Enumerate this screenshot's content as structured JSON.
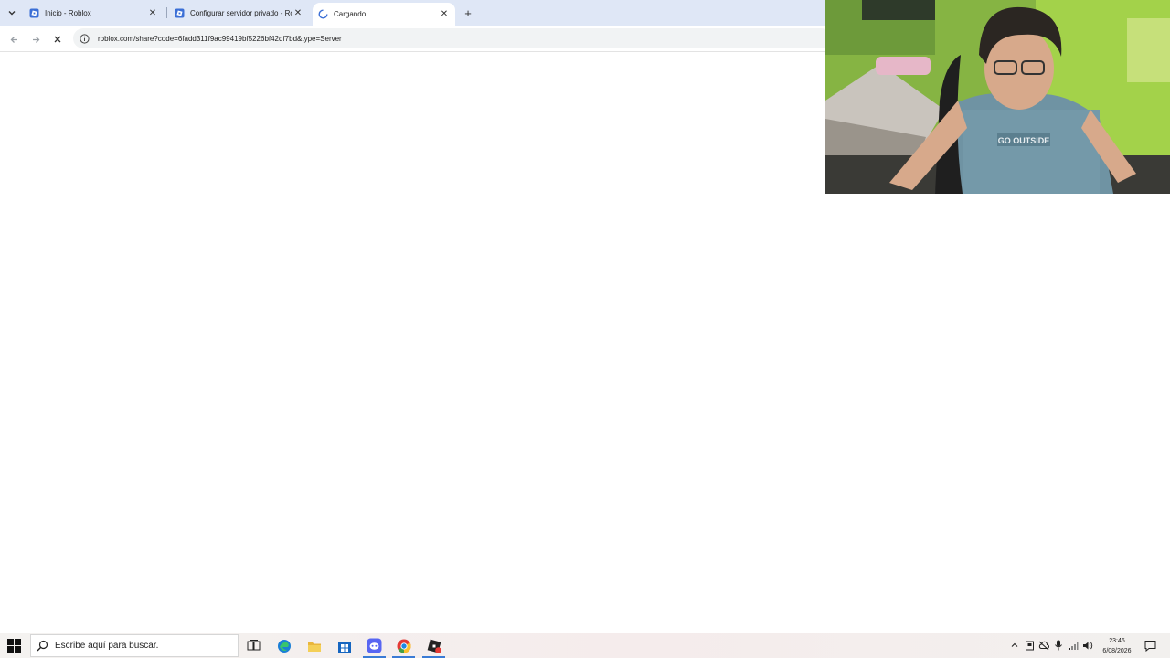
{
  "browser": {
    "tabs": [
      {
        "title": "Inicio - Roblox",
        "favicon": "roblox-icon",
        "active": false
      },
      {
        "title": "Configurar servidor privado - Ro",
        "favicon": "roblox-icon",
        "active": false
      },
      {
        "title": "Cargando...",
        "favicon": "loading-spinner-icon",
        "active": true
      }
    ],
    "url": "roblox.com/share?code=6fadd311f9ac99419bf5226bf42df7bd&type=Server",
    "loading": true
  },
  "webcam": {
    "shirt_text": "GO OUTSIDE"
  },
  "taskbar": {
    "search_placeholder": "Escribe aquí para buscar.",
    "pinned_apps": [
      "task-view-icon",
      "edge-icon",
      "file-explorer-icon",
      "store-icon",
      "discord-icon",
      "chrome-icon",
      "roblox-icon"
    ],
    "clock_time": "23:46",
    "clock_date": "6/08/2026"
  },
  "colors": {
    "tabstrip_bg": "#dfe7f6",
    "roblox_favicon": "#3b6fd6",
    "taskbar_accent": "#3a7bd5"
  }
}
